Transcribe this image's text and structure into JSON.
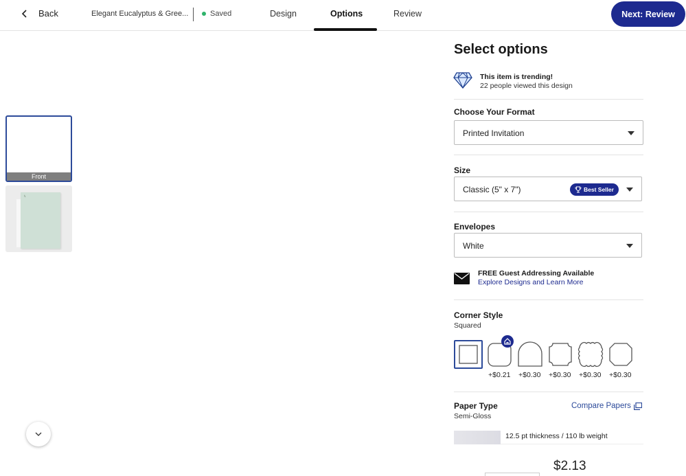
{
  "header": {
    "back_label": "Back",
    "doc_title": "Elegant Eucalyptus & Gree...",
    "saved_label": "Saved",
    "tabs": [
      {
        "label": "Design",
        "active": false
      },
      {
        "label": "Options",
        "active": true
      },
      {
        "label": "Review",
        "active": false
      }
    ],
    "next_label": "Next: Review"
  },
  "preview": {
    "thumbnails": [
      {
        "caption": "Front",
        "selected": true
      },
      {
        "caption": "",
        "selected": false
      }
    ],
    "scroll_icon": "chevron-down-icon"
  },
  "options": {
    "title": "Select options",
    "trending": {
      "icon": "diamond-icon",
      "title": "This item is trending!",
      "subtitle": "22 people viewed this design"
    },
    "format": {
      "label": "Choose Your Format",
      "value": "Printed Invitation"
    },
    "size": {
      "label": "Size",
      "value": "Classic (5\" x 7\")",
      "badge": "Best Seller"
    },
    "envelopes": {
      "label": "Envelopes",
      "value": "White"
    },
    "addressing": {
      "icon": "envelope-icon",
      "title": "FREE Guest Addressing Available",
      "link": "Explore Designs and Learn More"
    },
    "corner_style": {
      "label": "Corner Style",
      "selected": "Squared",
      "options": [
        {
          "name": "squared",
          "price": ""
        },
        {
          "name": "rounded",
          "price": "+$0.21"
        },
        {
          "name": "arch",
          "price": "+$0.30"
        },
        {
          "name": "ticket",
          "price": "+$0.30"
        },
        {
          "name": "scallop",
          "price": "+$0.30"
        },
        {
          "name": "bracket",
          "price": "+$0.30"
        }
      ]
    },
    "paper_type": {
      "label": "Paper Type",
      "selected": "Semi-Gloss",
      "compare_label": "Compare Papers",
      "description": "12.5 pt thickness / 110 lb weight"
    },
    "unit_price": "$2.13"
  },
  "colors": {
    "brand": "#1d2a8f",
    "saved_dot": "#2fb36b"
  }
}
